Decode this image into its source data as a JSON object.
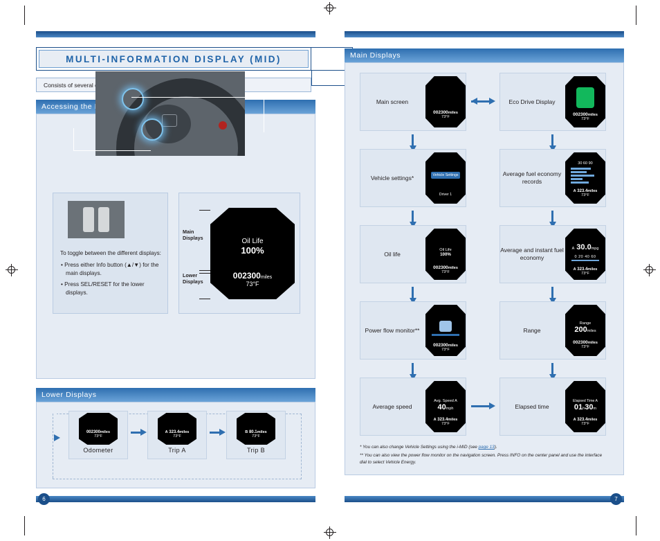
{
  "left_page": {
    "title": "MULTI-INFORMATION DISPLAY (MID)",
    "subtitle": "Consists of several displays that provide you with useful information.",
    "section1": {
      "heading": "Accessing the Information Display",
      "toggle_text_intro": "To toggle between the different displays:",
      "bullets": [
        "• Press either Info button (▲/▼) for the main displays.",
        "• Press SEL/RESET for the lower displays."
      ],
      "brace_labels": {
        "main": "Main\nDisplays",
        "lower": "Lower\nDisplays"
      },
      "mid_sample": {
        "line1": "Oil Life",
        "line2": "100%",
        "odometer": "002300",
        "odometer_unit": "miles",
        "temp": "73°F"
      }
    },
    "section2": {
      "heading": "Lower Displays",
      "items": [
        {
          "caption": "Odometer",
          "screen_top": "",
          "screen_main": "002300",
          "screen_unit": "miles",
          "screen_sub": "73°F"
        },
        {
          "caption": "Trip A",
          "screen_top": "A",
          "screen_main": "323.4",
          "screen_unit": "miles",
          "screen_sub": "73°F"
        },
        {
          "caption": "Trip B",
          "screen_top": "B",
          "screen_main": "80.1",
          "screen_unit": "miles",
          "screen_sub": "73°F"
        }
      ]
    },
    "page_number": "6"
  },
  "right_page": {
    "heading": "Main Displays",
    "flow": [
      {
        "caption": "Main screen",
        "screen": {
          "main": "",
          "odometer": "002300",
          "unit": "miles",
          "temp": "73°F"
        }
      },
      {
        "caption": "Eco Drive Display",
        "screen": {
          "main": "",
          "odometer": "002300",
          "unit": "miles",
          "temp": "73°F"
        }
      },
      {
        "caption": "Vehicle settings*",
        "screen": {
          "title": "Vehicle Settings",
          "sub": "Driver 1"
        }
      },
      {
        "caption": "Average fuel economy records",
        "screen": {
          "scale": "30  60  90",
          "trip": "A",
          "dist": "323.4",
          "unit": "miles",
          "temp": "73°F"
        }
      },
      {
        "caption": "Oil life",
        "screen": {
          "l1": "Oil Life",
          "l2": "100%",
          "odometer": "002300",
          "unit": "miles",
          "temp": "73°F"
        }
      },
      {
        "caption": "Average and instant fuel economy",
        "screen": {
          "trip": "A",
          "value": "30.0",
          "unit": "mpg",
          "gauge": "0   20   40   60",
          "trip2": "A",
          "dist": "323.4",
          "dunit": "miles",
          "temp": "73°F"
        }
      },
      {
        "caption": "Power flow monitor**",
        "screen": {
          "odometer": "002300",
          "unit": "miles",
          "temp": "73°F"
        }
      },
      {
        "caption": "Range",
        "screen": {
          "title": "Range",
          "value": "200",
          "unit": "miles",
          "odometer": "002300",
          "ounit": "miles",
          "temp": "73°F"
        }
      },
      {
        "caption": "Average speed",
        "screen": {
          "title": "Avg. Speed A",
          "value": "40",
          "unit": "mph",
          "trip": "A",
          "dist": "323.4",
          "dunit": "miles",
          "temp": "73°F"
        }
      },
      {
        "caption": "Elapsed time",
        "screen": {
          "title": "Elapsed Time A",
          "h": "01",
          "hu": "h",
          "m": "30",
          "mu": "m",
          "trip": "A",
          "dist": "323.4",
          "dunit": "miles",
          "temp": "73°F"
        }
      }
    ],
    "footnotes": {
      "one_pre": "* You can also change Vehicle Settings using the i-MID (see ",
      "one_link": "page 13",
      "one_post": ").",
      "two": "** You can also view the power flow monitor on the navigation screen. Press INFO on the center panel and use the interface dial to select Vehicle Energy."
    },
    "page_number": "7"
  }
}
